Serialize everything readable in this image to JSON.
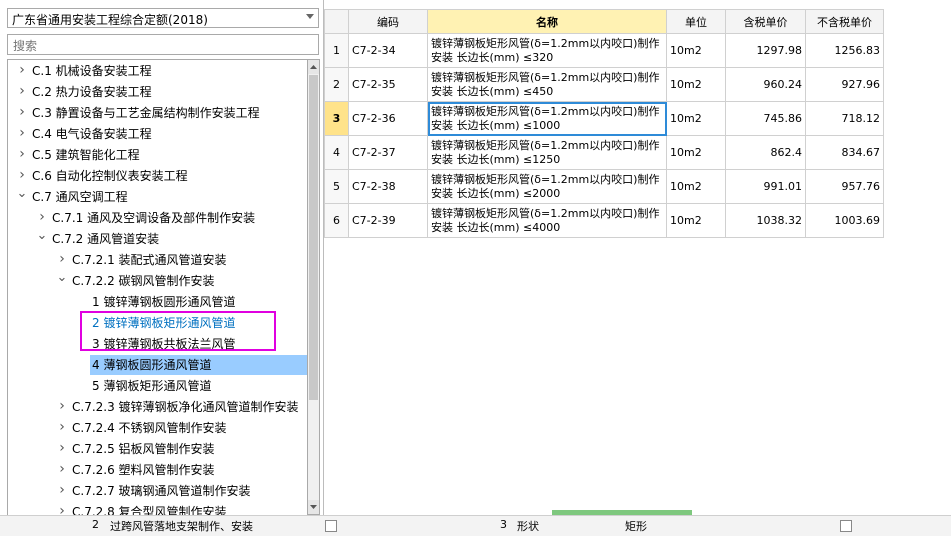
{
  "quota_combo": {
    "value": "广东省通用安装工程综合定额(2018)"
  },
  "search": {
    "placeholder": "搜索"
  },
  "tree": [
    {
      "label": "C.1 机械设备安装工程",
      "depth": 0,
      "state": "collapsed"
    },
    {
      "label": "C.2 热力设备安装工程",
      "depth": 0,
      "state": "collapsed"
    },
    {
      "label": "C.3 静置设备与工艺金属结构制作安装工程",
      "depth": 0,
      "state": "collapsed"
    },
    {
      "label": "C.4 电气设备安装工程",
      "depth": 0,
      "state": "collapsed"
    },
    {
      "label": "C.5 建筑智能化工程",
      "depth": 0,
      "state": "collapsed"
    },
    {
      "label": "C.6 自动化控制仪表安装工程",
      "depth": 0,
      "state": "collapsed"
    },
    {
      "label": "C.7 通风空调工程",
      "depth": 0,
      "state": "expanded"
    },
    {
      "label": "C.7.1 通风及空调设备及部件制作安装",
      "depth": 1,
      "state": "collapsed"
    },
    {
      "label": "C.7.2 通风管道安装",
      "depth": 1,
      "state": "expanded"
    },
    {
      "label": "C.7.2.1 装配式通风管道安装",
      "depth": 2,
      "state": "collapsed"
    },
    {
      "label": "C.7.2.2 碳钢风管制作安装",
      "depth": 2,
      "state": "expanded"
    },
    {
      "label": "1 镀锌薄钢板圆形通风管道",
      "depth": 3,
      "state": "leaf"
    },
    {
      "label": "2 镀锌薄钢板矩形通风管道",
      "depth": 3,
      "state": "leaf",
      "highlight": true
    },
    {
      "label": "3 镀锌薄钢板共板法兰风管",
      "depth": 3,
      "state": "leaf"
    },
    {
      "label": "4 薄钢板圆形通风管道",
      "depth": 3,
      "state": "leaf",
      "selected": true
    },
    {
      "label": "5 薄钢板矩形通风管道",
      "depth": 3,
      "state": "leaf"
    },
    {
      "label": "C.7.2.3 镀锌薄钢板净化通风管道制作安装",
      "depth": 2,
      "state": "collapsed"
    },
    {
      "label": "C.7.2.4 不锈钢风管制作安装",
      "depth": 2,
      "state": "collapsed"
    },
    {
      "label": "C.7.2.5 铝板风管制作安装",
      "depth": 2,
      "state": "collapsed"
    },
    {
      "label": "C.7.2.6 塑料风管制作安装",
      "depth": 2,
      "state": "collapsed"
    },
    {
      "label": "C.7.2.7 玻璃钢通风管道制作安装",
      "depth": 2,
      "state": "collapsed"
    },
    {
      "label": "C.7.2.8 复合型风管制作安装",
      "depth": 2,
      "state": "collapsed"
    }
  ],
  "table": {
    "headers": [
      "",
      "编码",
      "名称",
      "单位",
      "含税单价",
      "不含税单价"
    ],
    "rows": [
      {
        "n": "1",
        "code": "C7-2-34",
        "name": "镀锌薄钢板矩形风管(δ=1.2mm以内咬口)制作安装 长边长(mm) ≤320",
        "unit": "10m2",
        "price_tax": "1297.98",
        "price_notax": "1256.83"
      },
      {
        "n": "2",
        "code": "C7-2-35",
        "name": "镀锌薄钢板矩形风管(δ=1.2mm以内咬口)制作安装 长边长(mm) ≤450",
        "unit": "10m2",
        "price_tax": "960.24",
        "price_notax": "927.96"
      },
      {
        "n": "3",
        "code": "C7-2-36",
        "name": "镀锌薄钢板矩形风管(δ=1.2mm以内咬口)制作安装 长边长(mm) ≤1000",
        "unit": "10m2",
        "price_tax": "745.86",
        "price_notax": "718.12",
        "selected": true
      },
      {
        "n": "4",
        "code": "C7-2-37",
        "name": "镀锌薄钢板矩形风管(δ=1.2mm以内咬口)制作安装 长边长(mm) ≤1250",
        "unit": "10m2",
        "price_tax": "862.4",
        "price_notax": "834.67"
      },
      {
        "n": "5",
        "code": "C7-2-38",
        "name": "镀锌薄钢板矩形风管(δ=1.2mm以内咬口)制作安装 长边长(mm) ≤2000",
        "unit": "10m2",
        "price_tax": "991.01",
        "price_notax": "957.76"
      },
      {
        "n": "6",
        "code": "C7-2-39",
        "name": "镀锌薄钢板矩形风管(δ=1.2mm以内咬口)制作安装 长边长(mm) ≤4000",
        "unit": "10m2",
        "price_tax": "1038.32",
        "price_notax": "1003.69"
      }
    ]
  },
  "bottom": {
    "left": {
      "n": "2",
      "text": "过跨风管落地支架制作、安装"
    },
    "right": {
      "n": "3",
      "name": "形状",
      "value": "矩形"
    }
  },
  "colors": {
    "highlight_box": "#e000e0",
    "selected_tree": "#99ccff",
    "selected_row_num": "#ffe38a",
    "name_header": "#fff2b3",
    "name_link": "#0070c0"
  }
}
